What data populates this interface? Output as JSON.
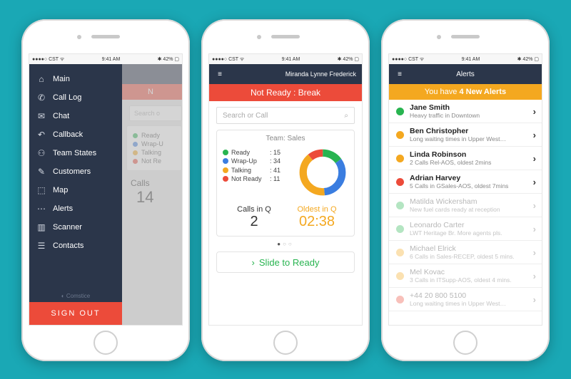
{
  "status": {
    "left": "●●●●○ CST ᯤ",
    "time": "9:41 AM",
    "right": "✱ 42% ▢"
  },
  "phone1": {
    "nav": {
      "back": "‹"
    },
    "red_partial": "N",
    "search_placeholder": "Search o",
    "legend": [
      {
        "color": "c-green",
        "label": "Ready"
      },
      {
        "color": "c-blue",
        "label": "Wrap-U"
      },
      {
        "color": "c-amber",
        "label": "Talking"
      },
      {
        "color": "c-red",
        "label": "Not Re"
      }
    ],
    "calls_lab": "Calls",
    "calls_num": "14",
    "menu": [
      {
        "icon": "⌂",
        "label": "Main",
        "name": "nav-main"
      },
      {
        "icon": "✆",
        "label": "Call Log",
        "name": "nav-call-log"
      },
      {
        "icon": "✉",
        "label": "Chat",
        "name": "nav-chat"
      },
      {
        "icon": "↶",
        "label": "Callback",
        "name": "nav-callback"
      },
      {
        "icon": "⚇",
        "label": "Team States",
        "name": "nav-team-states"
      },
      {
        "icon": "✎",
        "label": "Customers",
        "name": "nav-customers"
      },
      {
        "icon": "⬚",
        "label": "Map",
        "name": "nav-map"
      },
      {
        "icon": "⋯",
        "label": "Alerts",
        "name": "nav-alerts"
      },
      {
        "icon": "▥",
        "label": "Scanner",
        "name": "nav-scanner"
      },
      {
        "icon": "☰",
        "label": "Contacts",
        "name": "nav-contacts"
      }
    ],
    "brand": "◐ Comstice",
    "signout": "SIGN OUT"
  },
  "phone2": {
    "nav": {
      "user": "Miranda Lynne Frederick"
    },
    "red": "Not Ready : Break",
    "search_placeholder": "Search or Call",
    "team_label": "Team: Sales",
    "legend": [
      {
        "color": "c-green",
        "label": "Ready",
        "value": "15"
      },
      {
        "color": "c-blue",
        "label": "Wrap-Up",
        "value": "34"
      },
      {
        "color": "c-amber",
        "label": "Talking",
        "value": "41"
      },
      {
        "color": "c-red",
        "label": "Not Ready",
        "value": "11"
      }
    ],
    "calls_q_lab": "Calls in Q",
    "calls_q_val": "2",
    "oldest_lab": "Oldest in Q",
    "oldest_val": "02:38",
    "slide": "Slide to Ready"
  },
  "phone3": {
    "nav": {
      "title": "Alerts"
    },
    "banner_pre": "You have ",
    "banner_bold": "4 New Alerts",
    "items": [
      {
        "color": "c-green",
        "name": "Jane Smith",
        "sub": "Heavy traffic in Downtown",
        "unread": true
      },
      {
        "color": "c-amber",
        "name": "Ben Christopher",
        "sub": "Long waiting times in Upper West…",
        "unread": true
      },
      {
        "color": "c-amber",
        "name": "Linda Robinson",
        "sub": "2 Calls Rel-AOS, oldest 2mins",
        "unread": true
      },
      {
        "color": "c-red",
        "name": "Adrian Harvey",
        "sub": "5 Calls in GSales-AOS, oldest 7mins",
        "unread": true
      },
      {
        "color": "c-green",
        "name": "Matilda Wickersham",
        "sub": "New fuel cards ready at reception",
        "unread": false
      },
      {
        "color": "c-green",
        "name": "Leonardo Carter",
        "sub": "LWT Heritage Br. More agents pls.",
        "unread": false
      },
      {
        "color": "c-amber",
        "name": "Michael Elrick",
        "sub": "6 Calls in Sales-RECEP, oldest 5 mins.",
        "unread": false
      },
      {
        "color": "c-amber",
        "name": "Mel Kovac",
        "sub": "3 Calls in ITSupp-AOS, oldest 4 mins.",
        "unread": false
      },
      {
        "color": "c-red",
        "name": "+44 20 800 5100",
        "sub": "Long waiting times in Upper West…",
        "unread": false
      }
    ]
  },
  "chart_data": {
    "type": "pie",
    "title": "Team: Sales",
    "series": [
      {
        "name": "Ready",
        "value": 15,
        "color": "#28b450"
      },
      {
        "name": "Wrap-Up",
        "value": 34,
        "color": "#3a7de0"
      },
      {
        "name": "Talking",
        "value": 41,
        "color": "#f4a820"
      },
      {
        "name": "Not Ready",
        "value": 11,
        "color": "#ec4b3a"
      }
    ]
  }
}
